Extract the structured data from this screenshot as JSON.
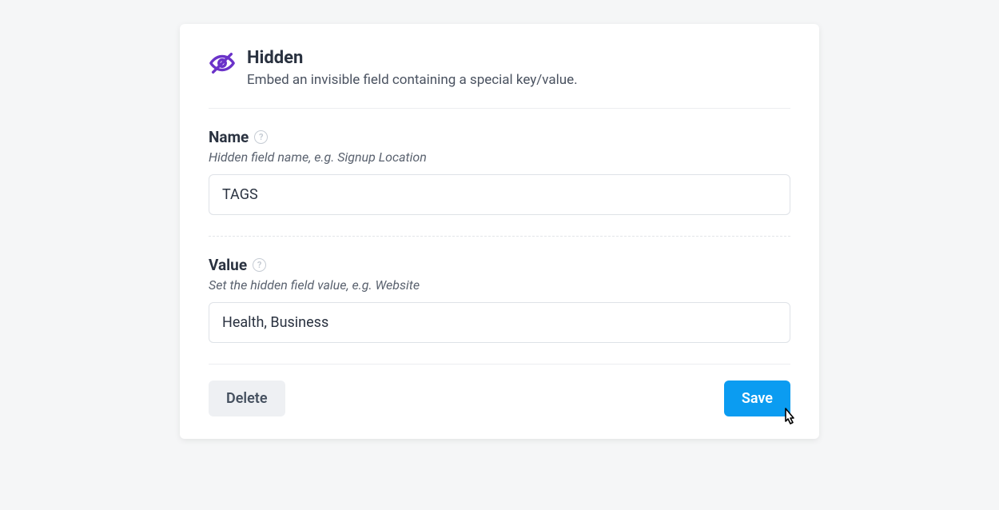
{
  "header": {
    "title": "Hidden",
    "subtitle": "Embed an invisible field containing a special key/value."
  },
  "name": {
    "label": "Name",
    "hint": "Hidden field name, e.g. Signup Location",
    "value": "TAGS"
  },
  "value": {
    "label": "Value",
    "hint": "Set the hidden field value, e.g. Website",
    "value": "Health, Business"
  },
  "actions": {
    "delete": "Delete",
    "save": "Save"
  }
}
